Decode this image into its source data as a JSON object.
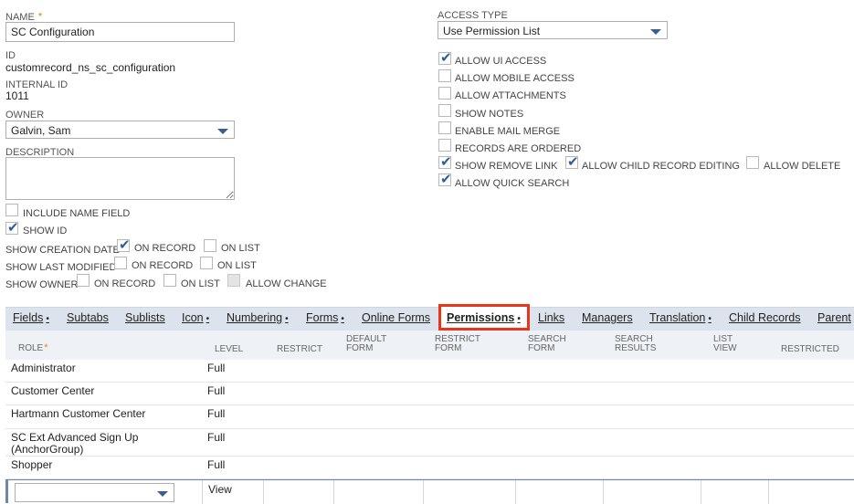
{
  "left": {
    "name_label": "NAME",
    "name_required": "*",
    "name_value": "SC Configuration",
    "id_label": "ID",
    "id_value": "customrecord_ns_sc_configuration",
    "internal_id_label": "INTERNAL ID",
    "internal_id_value": "1011",
    "owner_label": "OWNER",
    "owner_value": "Galvin, Sam",
    "description_label": "DESCRIPTION",
    "description_value": "",
    "include_name_field": "INCLUDE NAME FIELD",
    "show_id": "SHOW ID",
    "show_creation_date": "SHOW CREATION DATE",
    "show_last_modified": "SHOW LAST MODIFIED",
    "show_owner": "SHOW OWNER",
    "on_record": "ON RECORD",
    "on_list": "ON LIST",
    "allow_change": "ALLOW CHANGE"
  },
  "right": {
    "access_type_label": "ACCESS TYPE",
    "access_type_value": "Use Permission List",
    "allow_ui_access": "ALLOW UI ACCESS",
    "allow_mobile_access": "ALLOW MOBILE ACCESS",
    "allow_attachments": "ALLOW ATTACHMENTS",
    "show_notes": "SHOW NOTES",
    "enable_mail_merge": "ENABLE MAIL MERGE",
    "records_are_ordered": "RECORDS ARE ORDERED",
    "show_remove_link": "SHOW REMOVE LINK",
    "allow_child_record_editing": "ALLOW CHILD RECORD EDITING",
    "allow_delete": "ALLOW DELETE",
    "allow_quick_search": "ALLOW QUICK SEARCH"
  },
  "tabs": [
    {
      "label": "Fields",
      "dot": "•"
    },
    {
      "label": "Subtabs",
      "dot": ""
    },
    {
      "label": "Sublists",
      "dot": ""
    },
    {
      "label": "Icon",
      "dot": "•"
    },
    {
      "label": "Numbering",
      "dot": "•"
    },
    {
      "label": "Forms",
      "dot": "•"
    },
    {
      "label": "Online Forms",
      "dot": ""
    },
    {
      "label": "Permissions",
      "dot": "•"
    },
    {
      "label": "Links",
      "dot": ""
    },
    {
      "label": "Managers",
      "dot": ""
    },
    {
      "label": "Translation",
      "dot": "•"
    },
    {
      "label": "Child Records",
      "dot": ""
    },
    {
      "label": "Parent",
      "dot": ""
    }
  ],
  "table": {
    "headers": {
      "role": "ROLE",
      "role_required": "*",
      "level": "LEVEL",
      "restrict": "RESTRICT",
      "default_form_1": "DEFAULT",
      "default_form_2": "FORM",
      "restrict_form_1": "RESTRICT",
      "restrict_form_2": "FORM",
      "search_form_1": "SEARCH",
      "search_form_2": "FORM",
      "search_results_1": "SEARCH",
      "search_results_2": "RESULTS",
      "list_view_1": "LIST",
      "list_view_2": "VIEW",
      "restricted": "RESTRICTED"
    },
    "rows": [
      {
        "role": "Administrator",
        "level": "Full"
      },
      {
        "role": "Customer Center",
        "level": "Full"
      },
      {
        "role": "Hartmann Customer Center",
        "level": "Full"
      },
      {
        "role": "SC Ext Advanced Sign Up",
        "role2": "(AnchorGroup)",
        "level": "Full"
      },
      {
        "role": "Shopper",
        "level": "Full"
      }
    ],
    "edit_row": {
      "role": "",
      "level": "View"
    }
  }
}
